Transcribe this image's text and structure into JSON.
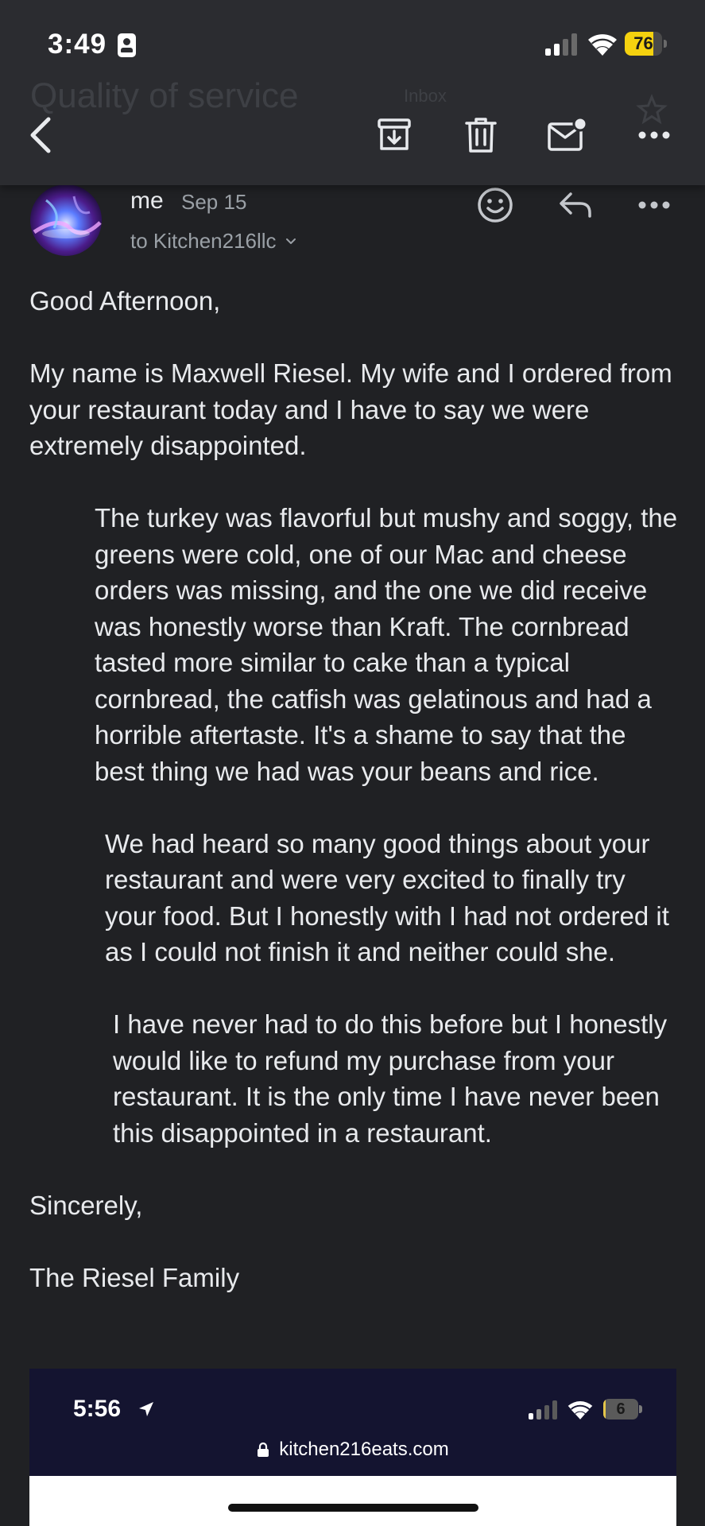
{
  "status_bar": {
    "time": "3:49",
    "battery": "76",
    "battery_level": 0.76
  },
  "toolbar": {
    "subject": "Quality of service",
    "label": "Inbox"
  },
  "message": {
    "sender": "me",
    "date": "Sep 15",
    "recipient": "to Kitchen216llc",
    "paragraphs": [
      "Good Afternoon,",
      "My name is Maxwell Riesel. My wife and I ordered from your restaurant today and I have to say we were extremely disappointed.",
      "The turkey was flavorful but mushy and soggy, the greens were cold, one of our Mac and cheese orders was missing, and the one we did receive was honestly worse than Kraft. The cornbread tasted more similar to cake than a typical cornbread, the catfish was gelatinous and had a horrible aftertaste. It's a shame to say that the best thing we had was your beans and rice.",
      "We had heard so many good things about your restaurant and were very excited to finally try your food. But I honestly with I had not ordered it as I could not finish it and neither could she.",
      "I have never had to do this before but I honestly would like to refund my purchase from your restaurant. It is the only time I have never been this disappointed in a restaurant.",
      "Sincerely,",
      "The Riesel Family"
    ]
  },
  "embedded_screenshot": {
    "time": "5:56",
    "battery": "6",
    "battery_level": 0.06,
    "url": "kitchen216eats.com"
  },
  "colors": {
    "background": "#202124",
    "toolbar": "#2b2c30",
    "text": "#e8eaed",
    "secondary_text": "#9aa0a6",
    "battery_yellow": "#f5d20f"
  }
}
